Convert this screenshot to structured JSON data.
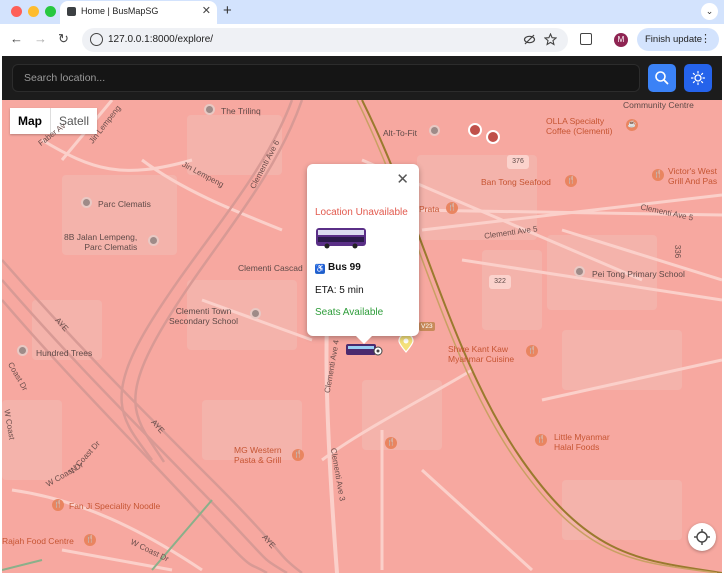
{
  "browser": {
    "tab_title": "Home | BusMapSG",
    "tab_close": "✕",
    "new_tab": "+",
    "tab_menu": "⌄",
    "back": "←",
    "forward": "→",
    "reload": "↻",
    "url": "127.0.0.1:8000/explore/",
    "avatar_letter": "M",
    "update_label": "Finish update",
    "update_menu": "⋮"
  },
  "app": {
    "search_placeholder": "Search location...",
    "search_value": "",
    "accent_color": "#3b82f6"
  },
  "map": {
    "types": [
      "Map",
      "Satell"
    ],
    "active_type": "Map",
    "places": {
      "trilinq": "The Trilinq",
      "community": "Community Centre",
      "altofit": "Alt-To-Fit",
      "olla": "OLLA Specialty\nCoffee (Clementi)",
      "victors": "Victor's West\nGrill And Pas",
      "bantong": "Ban Tong Seafood",
      "prata": "Prata",
      "parc": "Parc Clematis",
      "jalan": "8B Jalan Lempeng,\nParc Clematis",
      "cascadia": "Clementi Cascad",
      "peitong": "Pei Tong Primary School",
      "clementi_town": "Clementi Town\nSecondary School",
      "hundred": "Hundred Trees",
      "shwe": "Shwe Kant Kaw\nMyanmar Cuisine",
      "mgwestern": "MG Western\nPasta & Grill",
      "little_myanmar": "Little Myanmar\nHalal Foods",
      "fanji": "Fan Ji Speciality Noodle",
      "rajah": "Rajah Food Centre"
    },
    "roads": {
      "faber": "Faber Av",
      "jin_lempeng_1": "Jin Lempeng",
      "jin_lempeng_2": "Jin Lempeng",
      "clementi_ave6": "Clementi Ave 6",
      "clementi_ave5_1": "Clementi Ave 5",
      "clementi_ave5_2": "Clementi Ave 5",
      "clementi_ave4": "Clementi Ave 4",
      "clementi_ave3": "Clementi Ave 3",
      "aye1": "AYE",
      "aye2": "AYE",
      "aye3": "AYE",
      "w_coast_dr_1": "W Coast Dr",
      "w_coast_dr_2": "W Coast Dr",
      "w_coast_dr_3": "W Coast Dr",
      "coast_dr": "Coast Dr",
      "w_coast": "W Coast",
      "num_376": "376",
      "num_322": "322",
      "num_336": "336",
      "v23": "V23"
    }
  },
  "popup": {
    "close": "✕",
    "location_status": "Location Unavailable",
    "bus_label": "Bus 99",
    "wheelchair": "♿",
    "eta_label": "ETA: 5 min",
    "seats": "Seats Available",
    "status_color": "#e25a4e",
    "seats_color": "#2e9d3a"
  }
}
